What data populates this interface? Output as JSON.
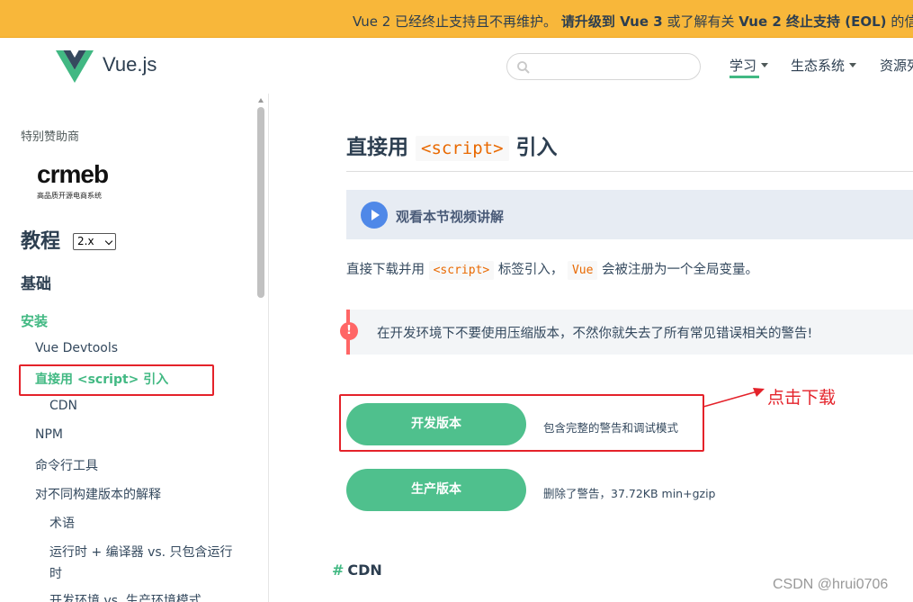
{
  "banner": {
    "text_before": "Vue 2 已经终止支持且不再维护。",
    "text_bold": "请升级到 Vue 3",
    "text_mid": "或了解有关",
    "text_bold2": "Vue 2 终止支持 (EOL)",
    "text_after": "的信息。"
  },
  "header": {
    "brand": "Vue.js",
    "search": {
      "placeholder": "",
      "value": ""
    },
    "nav": [
      "学习",
      "生态系统",
      "资源列"
    ]
  },
  "sidebar": {
    "sponsor_label": "特别赞助商",
    "sponsor_logo_text": "crmeb",
    "sponsor_logo_sub": "高品质开源电商系统",
    "title": "教程",
    "version": "2.x",
    "section": "基础",
    "items": [
      {
        "label": "安装"
      },
      {
        "label": "Vue Devtools"
      },
      {
        "label": "直接用 <script> 引入"
      },
      {
        "label": "CDN"
      },
      {
        "label": "NPM"
      },
      {
        "label": "命令行工具"
      },
      {
        "label": "对不同构建版本的解释"
      },
      {
        "label": "术语"
      },
      {
        "label": "运行时 + 编译器 vs. 只包含运行"
      },
      {
        "label": "时"
      },
      {
        "label": "开发环境 vs. 生产环境模式"
      }
    ]
  },
  "content": {
    "title_before": "直接用",
    "title_code": "<script>",
    "title_after": "引入",
    "video_label": "观看本节视频讲解",
    "para_before": "直接下载并用",
    "para_code1": "<script>",
    "para_mid": "标签引入，",
    "para_code2": "Vue",
    "para_after": "会被注册为一个全局变量。",
    "warning": "在开发环境下不要使用压缩版本，不然你就失去了所有常见错误相关的警告!",
    "dev_button": "开发版本",
    "dev_desc": "包含完整的警告和调试模式",
    "prod_button": "生产版本",
    "prod_desc": "删除了警告，37.72KB min+gzip",
    "next_heading_hash": "#",
    "next_heading": "CDN"
  },
  "annotation": {
    "text": "点击下载"
  },
  "watermark": "CSDN @hrui0706",
  "colors": {
    "accent": "#42b983",
    "button": "#4fc08d",
    "banner": "#f8b73a",
    "annotation": "#e4222a"
  }
}
